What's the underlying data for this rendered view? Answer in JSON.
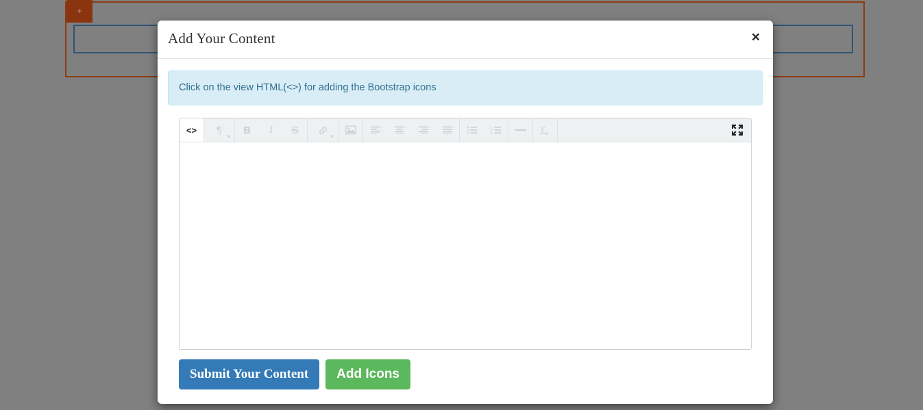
{
  "background": {
    "tab_label": "+",
    "panel_border_color": "#8c3a12",
    "tab_color": "#8a3410",
    "input_border_color": "#2f5575"
  },
  "modal": {
    "title": "Add Your Content",
    "close_label": "×",
    "alert": {
      "text": "Click on the view HTML(<>) for adding the Bootstrap icons",
      "background": "#d9edf7",
      "border": "#bce8f1",
      "text_color": "#31708f"
    },
    "editor": {
      "content": "",
      "toolbar": {
        "groups": [
          {
            "buttons": [
              {
                "name": "view-html-button",
                "label": "<>",
                "icon": "code-icon",
                "active": true,
                "caret": false
              }
            ]
          },
          {
            "buttons": [
              {
                "name": "paragraph-style-button",
                "label": "¶",
                "icon": "pilcrow-icon",
                "active": false,
                "caret": true
              }
            ]
          },
          {
            "buttons": [
              {
                "name": "bold-button",
                "label": "B",
                "icon": "bold-icon",
                "active": false,
                "caret": false
              },
              {
                "name": "italic-button",
                "label": "I",
                "icon": "italic-icon",
                "active": false,
                "caret": false
              },
              {
                "name": "strikethrough-button",
                "label": "S",
                "icon": "strikethrough-icon",
                "active": false,
                "caret": false
              }
            ]
          },
          {
            "buttons": [
              {
                "name": "insert-link-button",
                "label": "",
                "icon": "link-icon",
                "active": false,
                "caret": true
              }
            ]
          },
          {
            "buttons": [
              {
                "name": "insert-image-button",
                "label": "",
                "icon": "image-icon",
                "active": false,
                "caret": false
              }
            ]
          },
          {
            "buttons": [
              {
                "name": "align-left-button",
                "label": "",
                "icon": "align-left-icon",
                "active": false,
                "caret": false
              },
              {
                "name": "align-center-button",
                "label": "",
                "icon": "align-center-icon",
                "active": false,
                "caret": false
              },
              {
                "name": "align-right-button",
                "label": "",
                "icon": "align-right-icon",
                "active": false,
                "caret": false
              },
              {
                "name": "align-justify-button",
                "label": "",
                "icon": "align-justify-icon",
                "active": false,
                "caret": false
              }
            ]
          },
          {
            "buttons": [
              {
                "name": "unordered-list-button",
                "label": "",
                "icon": "list-unordered-icon",
                "active": false,
                "caret": false
              },
              {
                "name": "ordered-list-button",
                "label": "",
                "icon": "list-ordered-icon",
                "active": false,
                "caret": false
              }
            ]
          },
          {
            "buttons": [
              {
                "name": "horizontal-rule-button",
                "label": "",
                "icon": "horizontal-rule-icon",
                "active": false,
                "caret": false
              }
            ]
          },
          {
            "buttons": [
              {
                "name": "clear-formatting-button",
                "label": "",
                "icon": "remove-format-icon",
                "active": false,
                "caret": false
              }
            ]
          }
        ],
        "fullscreen": {
          "name": "fullscreen-button",
          "icon": "expand-icon"
        }
      }
    },
    "footer": {
      "submit_label": "Submit Your Content",
      "submit_color": "#337ab7",
      "add_icons_label": "Add Icons",
      "add_icons_color": "#5cb85c"
    }
  }
}
